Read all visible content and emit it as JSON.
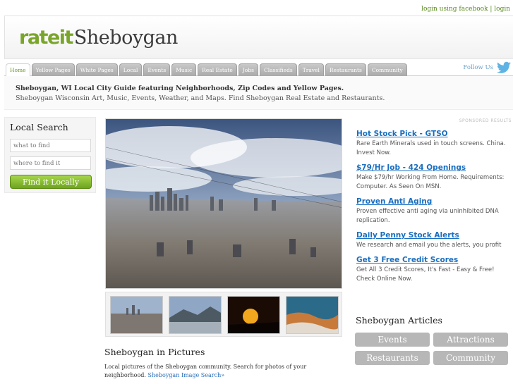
{
  "toplinks": {
    "login": "login using facebook",
    "separator": " | ",
    "register": "login"
  },
  "logo": {
    "rate": "rateit",
    "city": "Sheboygan"
  },
  "nav": {
    "tabs": [
      "Home",
      "Yellow Pages",
      "White Pages",
      "Local",
      "Events",
      "Music",
      "Real Estate",
      "Jobs",
      "Classifieds",
      "Travel",
      "Restaurants",
      "Community"
    ],
    "active": "Home",
    "follow": "Follow Us"
  },
  "tagline": {
    "line1": "Sheboygan, WI Local City Guide featuring Neighborhoods, Zip Codes and Yellow Pages.",
    "line2": "Sheboygan Wisconsin Art, Music, Events, Weather, and Maps. Find Sheboygan Real Estate and Restaurants."
  },
  "local_search": {
    "title": "Local Search",
    "what_placeholder": "what to find",
    "where_placeholder": "where to find it",
    "button": "Find it Locally"
  },
  "pictures": {
    "title": "Sheboygan in Pictures",
    "description": "Local pictures of the Sheboygan community. Search for photos of your neighborhood.",
    "link": "Sheboygan Image Search»"
  },
  "sponsored_label": "SPONSORED RESULTS",
  "ads": [
    {
      "title": "Hot Stock Pick - GTSO",
      "desc": "Rare Earth Minerals used in touch screens. China. Invest Now."
    },
    {
      "title": "$79/Hr Job - 424 Openings",
      "desc": "Make $79/hr Working From Home. Requirements: Computer. As Seen On MSN."
    },
    {
      "title": "Proven Anti Aging",
      "desc": "Proven effective anti aging via uninhibited DNA replication."
    },
    {
      "title": "Daily Penny Stock Alerts",
      "desc": "We research and email you the alerts, you profit"
    },
    {
      "title": "Get 3 Free Credit Scores",
      "desc": "Get All 3 Credit Scores, It's Fast - Easy & Free! Check Online Now."
    }
  ],
  "articles": {
    "title": "Sheboygan Articles",
    "buttons": [
      "Events",
      "Attractions",
      "Restaurants",
      "Community"
    ]
  },
  "colors": {
    "accent_green": "#7aa52b",
    "link_blue": "#1a6fc0",
    "tab_gray": "#b4b4b4"
  }
}
